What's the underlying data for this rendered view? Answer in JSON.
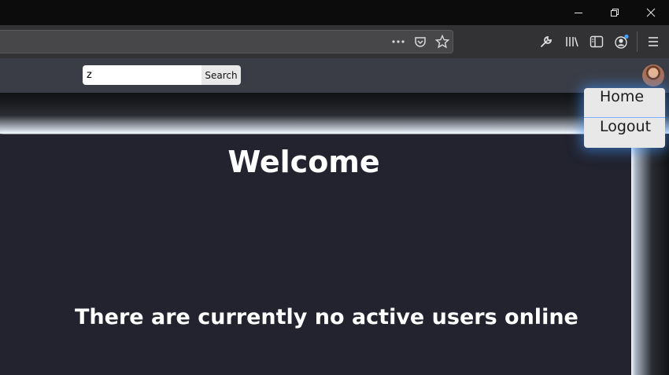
{
  "window": {
    "minimize_icon": "minimize-icon",
    "restore_icon": "restore-icon",
    "close_icon": "close-icon"
  },
  "toolbar": {
    "icons": [
      "more-icon",
      "pocket-icon",
      "bookmark-star-icon",
      "wrench-icon",
      "library-icon",
      "sidebar-icon",
      "account-icon",
      "menu-icon"
    ]
  },
  "page": {
    "search": {
      "value": "z",
      "button_label": "Search"
    },
    "dropdown": {
      "items": [
        {
          "label": "Home"
        },
        {
          "label": "Logout"
        }
      ]
    },
    "welcome_heading": "Welcome",
    "status_message": "There are currently no active users online"
  },
  "colors": {
    "accent_glow": "#4296ff",
    "page_bg": "#22232f",
    "navbar_bg": "#3a3d46"
  }
}
